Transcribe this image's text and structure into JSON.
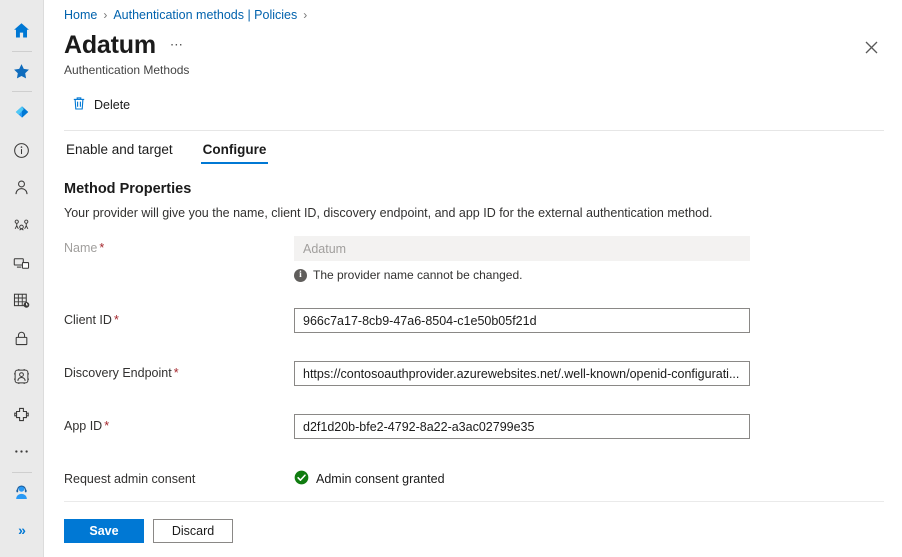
{
  "rail": {
    "items": [
      {
        "name": "home-icon",
        "label": "Home"
      },
      {
        "name": "favorites-icon",
        "label": "Favorites"
      },
      {
        "name": "azure-diamond-icon",
        "label": "Create a resource"
      },
      {
        "name": "info-circle-icon",
        "label": "Information"
      },
      {
        "name": "user-icon",
        "label": "Users"
      },
      {
        "name": "groups-icon",
        "label": "Groups"
      },
      {
        "name": "devices-icon",
        "label": "Devices"
      },
      {
        "name": "applications-grid-icon",
        "label": "Applications"
      },
      {
        "name": "lock-icon",
        "label": "Protection"
      },
      {
        "name": "identity-governance-icon",
        "label": "Identity governance"
      },
      {
        "name": "extensions-icon",
        "label": "Extensions"
      },
      {
        "name": "more-ellipsis-icon",
        "label": "More"
      },
      {
        "name": "support-agent-icon",
        "label": "Help and support"
      }
    ],
    "expand_label": "»"
  },
  "breadcrumb": {
    "items": [
      "Home",
      "Authentication methods | Policies"
    ],
    "separator": "›"
  },
  "header": {
    "title": "Adatum",
    "more_label": "⋯",
    "subtitle": "Authentication Methods",
    "close_label": "✕"
  },
  "commandbar": {
    "delete_label": "Delete",
    "delete_icon": "trash-icon"
  },
  "tabs": [
    {
      "label": "Enable and target",
      "active": false
    },
    {
      "label": "Configure",
      "active": true
    }
  ],
  "main": {
    "section_title": "Method Properties",
    "section_description": "Your provider will give you the name, client ID, discovery endpoint, and app ID for the external authentication method.",
    "fields": {
      "name": {
        "label": "Name",
        "required": "*",
        "value": "Adatum",
        "disabled": true,
        "hint": "The provider name cannot be changed.",
        "hint_icon": "info-icon"
      },
      "client_id": {
        "label": "Client ID",
        "required": "*",
        "value": "966c7a17-8cb9-47a6-8504-c1e50b05f21d"
      },
      "discovery_endpoint": {
        "label": "Discovery Endpoint",
        "required": "*",
        "value": "https://contosoauthprovider.azurewebsites.net/.well-known/openid-configurati..."
      },
      "app_id": {
        "label": "App ID",
        "required": "*",
        "value": "d2f1d20b-bfe2-4792-8a22-a3ac02799e35"
      },
      "admin_consent": {
        "label": "Request admin consent",
        "status_text": "Admin consent granted",
        "status_icon": "green-check-circle-icon"
      }
    }
  },
  "footer": {
    "save_label": "Save",
    "discard_label": "Discard"
  },
  "colors": {
    "accent": "#0078d4",
    "link": "#0062ad",
    "required": "#a4262c",
    "success": "#107c10",
    "rail_bg": "#eaeaea"
  }
}
